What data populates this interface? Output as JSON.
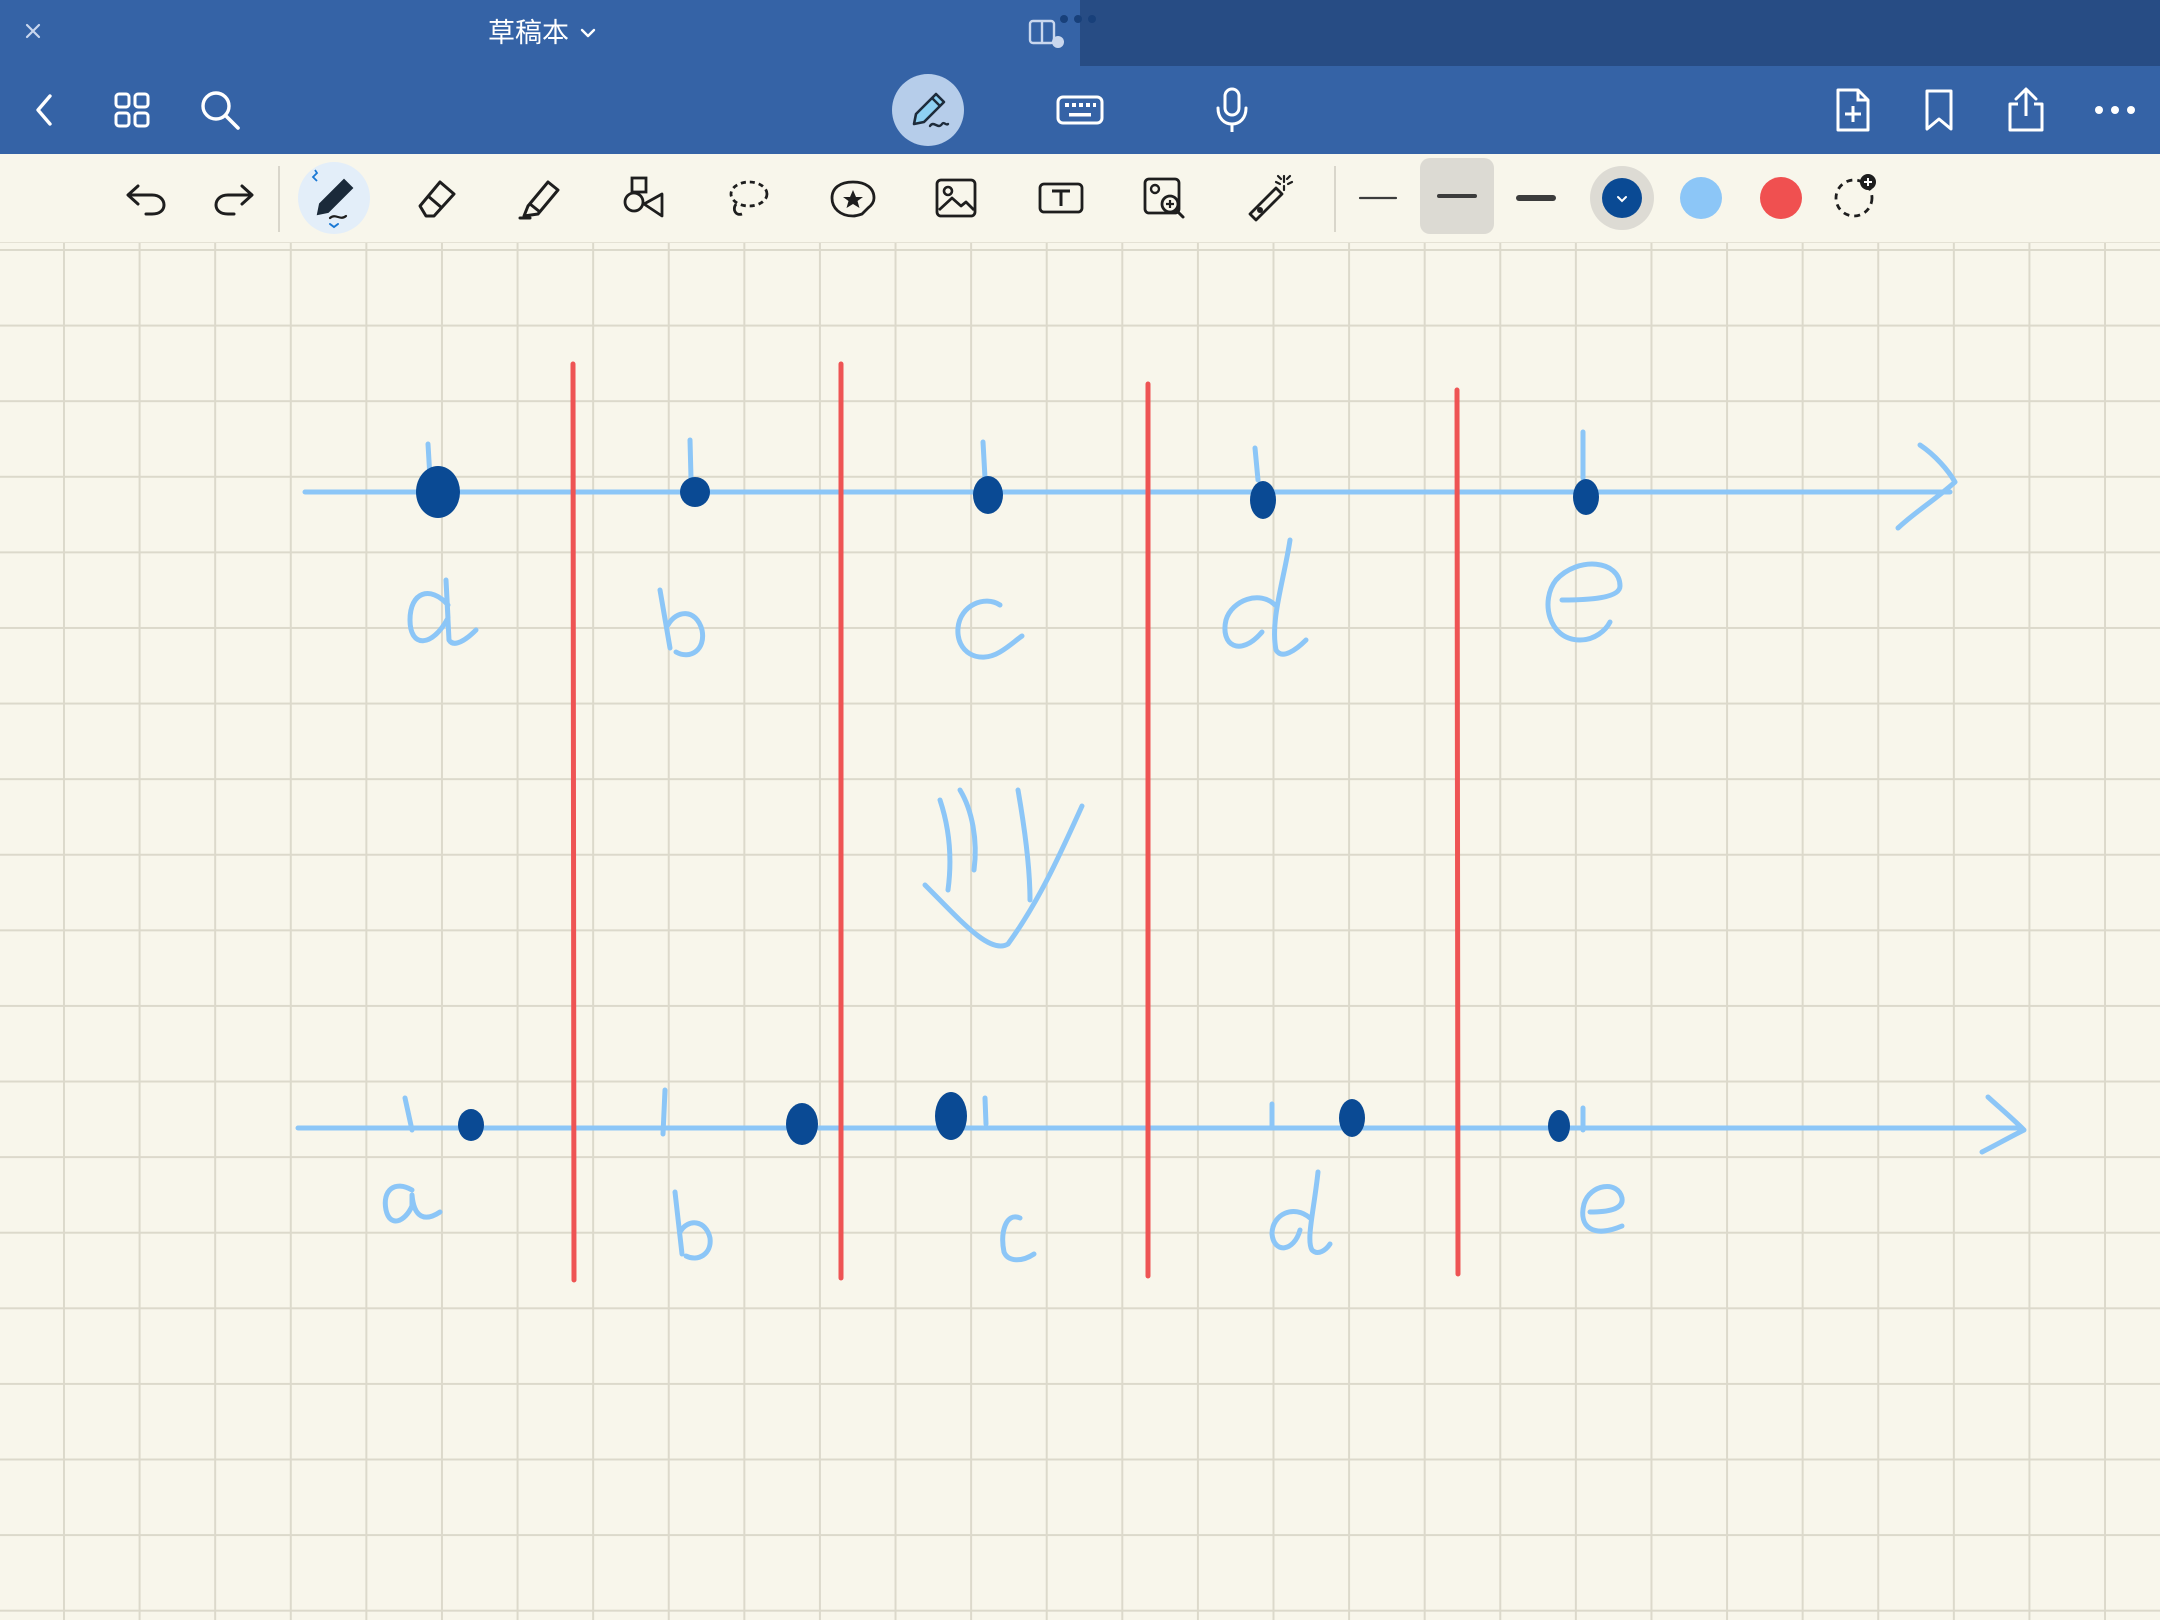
{
  "window": {
    "title": "草稿本",
    "title_chevron": "chevron-down-icon",
    "close_icon": "close-icon",
    "split_view_icon": "split-view-icon",
    "multitask_icon": "ellipsis-dots-icon"
  },
  "navbar": {
    "left": [
      "chevron-left-icon",
      "grid-icon",
      "search-icon"
    ],
    "center": [
      "pen-mode-icon",
      "keyboard-icon",
      "microphone-icon"
    ],
    "right": [
      "add-page-icon",
      "bookmark-icon",
      "share-icon",
      "more-icon"
    ]
  },
  "toolbar": {
    "tools": [
      "undo-icon",
      "redo-icon",
      "pen-icon",
      "eraser-icon",
      "highlighter-icon",
      "shapes-icon",
      "lasso-icon",
      "sticker-icon",
      "image-icon",
      "text-box-icon",
      "zoom-box-icon",
      "laser-pointer-icon"
    ],
    "selected_tool": "pen-icon",
    "stroke_widths": [
      "thin",
      "medium",
      "thick"
    ],
    "selected_width": "medium",
    "colors": [
      "#0A4A94",
      "#8CC6F7",
      "#F05050"
    ],
    "selected_color": "#0A4A94",
    "custom_color_icon": "add-color-icon"
  },
  "canvas": {
    "paper": "grid",
    "ink_colors": {
      "light_blue": "#8CC6F7",
      "dark_blue": "#0A4A94",
      "red": "#EE5454"
    },
    "top_axis_labels": [
      "a",
      "b",
      "c",
      "d",
      "e"
    ],
    "bottom_axis_labels": [
      "a",
      "b",
      "c",
      "d",
      "e"
    ],
    "middle_mark": "↓"
  }
}
